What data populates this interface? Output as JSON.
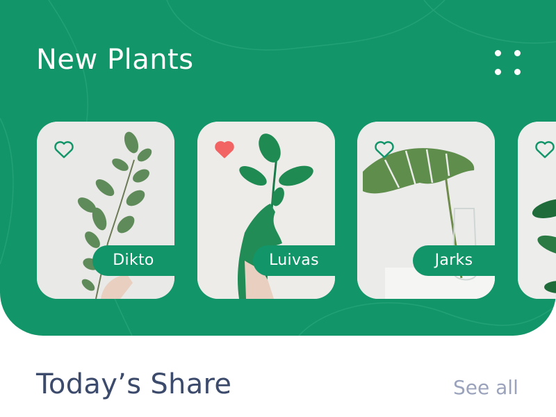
{
  "header": {
    "title": "New Plants",
    "menu_icon": "grid-dots-icon"
  },
  "plants": [
    {
      "name": "Dikto",
      "favorite": false
    },
    {
      "name": "Luivas",
      "favorite": true
    },
    {
      "name": "Jarks",
      "favorite": false
    },
    {
      "name": "",
      "favorite": false
    }
  ],
  "share": {
    "title": "Today’s Share",
    "see_all_label": "See all"
  },
  "colors": {
    "brand_green": "#13956a",
    "heart_active": "#f26464",
    "heading_text": "#3c4a6b",
    "link_text": "#9aa3bb"
  }
}
